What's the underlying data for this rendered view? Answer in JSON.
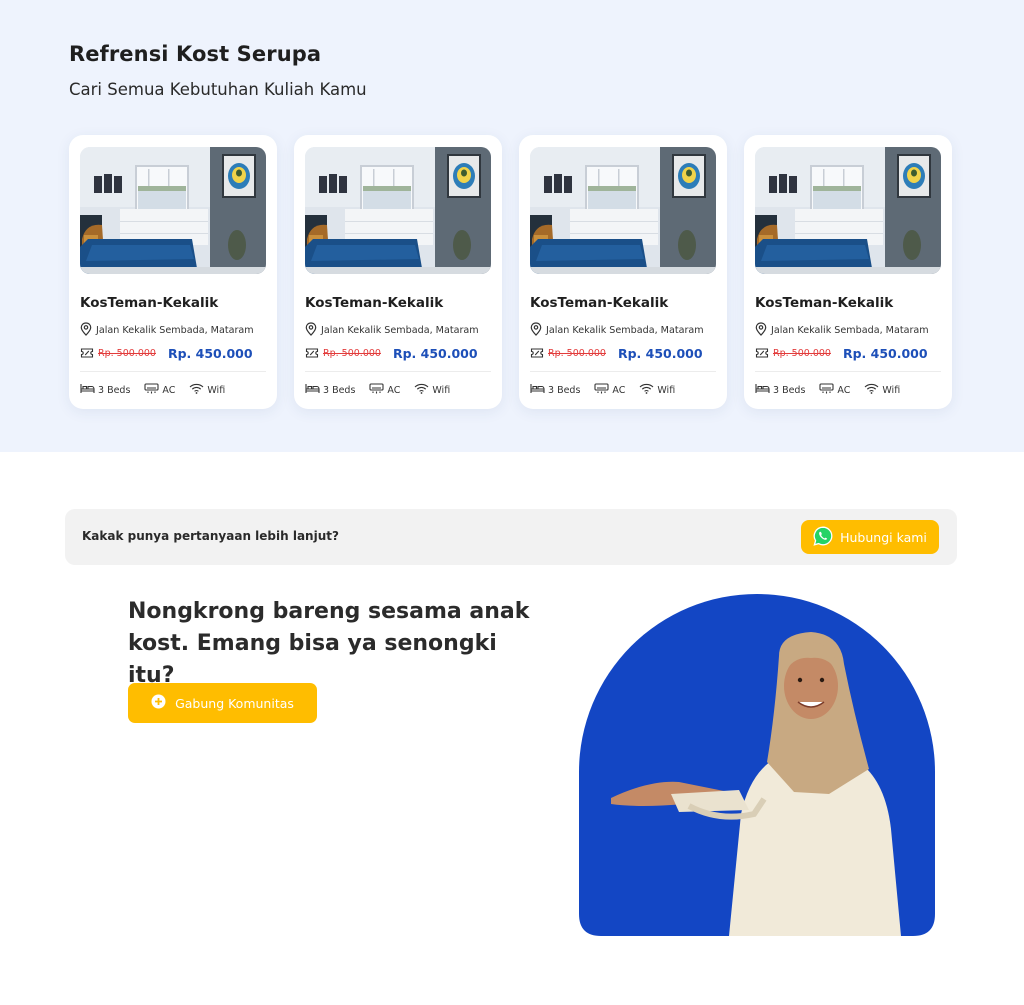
{
  "section": {
    "title": "Refrensi Kost Serupa",
    "subtitle": "Cari Semua Kebutuhan Kuliah Kamu"
  },
  "cards": [
    {
      "name": "KosTeman-Kekalik",
      "address": "Jalan Kekalik Sembada, Mataram",
      "old_price": "Rp. 500.000",
      "new_price": "Rp. 450.000",
      "features": {
        "beds": "3 Beds",
        "ac": "AC",
        "wifi": "Wifi"
      }
    },
    {
      "name": "KosTeman-Kekalik",
      "address": "Jalan Kekalik Sembada, Mataram",
      "old_price": "Rp. 500.000",
      "new_price": "Rp. 450.000",
      "features": {
        "beds": "3 Beds",
        "ac": "AC",
        "wifi": "Wifi"
      }
    },
    {
      "name": "KosTeman-Kekalik",
      "address": "Jalan Kekalik Sembada, Mataram",
      "old_price": "Rp. 500.000",
      "new_price": "Rp. 450.000",
      "features": {
        "beds": "3 Beds",
        "ac": "AC",
        "wifi": "Wifi"
      }
    },
    {
      "name": "KosTeman-Kekalik",
      "address": "Jalan Kekalik Sembada, Mataram",
      "old_price": "Rp. 500.000",
      "new_price": "Rp. 450.000",
      "features": {
        "beds": "3 Beds",
        "ac": "AC",
        "wifi": "Wifi"
      }
    }
  ],
  "faq": {
    "question": "Kakak punya pertanyaan lebih lanjut?",
    "button_label": "Hubungi kami",
    "button_icon": "whatsapp-icon"
  },
  "community": {
    "title": "Nongkrong bareng sesama anak kost. Emang bisa ya senongki itu?",
    "button_label": "Gabung Komunitas",
    "button_icon": "plus-circle-icon"
  },
  "colors": {
    "accent_yellow": "#ffbd00",
    "primary_blue": "#1d4fb8",
    "hero_blue": "#1346c4",
    "strike_red": "#e23b3b",
    "section_bg": "#eef3fd"
  }
}
